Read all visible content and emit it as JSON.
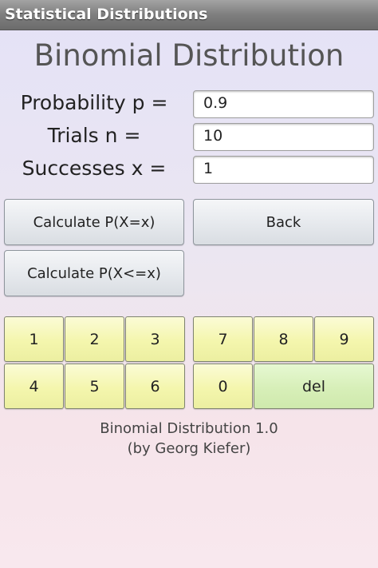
{
  "app": {
    "title": "Statistical Distributions"
  },
  "heading": "Binomial Distribution",
  "inputs": [
    {
      "label": "Probability p =",
      "value": "0.9"
    },
    {
      "label": "Trials n =",
      "value": "10"
    },
    {
      "label": "Successes x =",
      "value": "1"
    }
  ],
  "buttons": {
    "calc_eq": "Calculate P(X=x)",
    "back": "Back",
    "calc_le": "Calculate P(X<=x)"
  },
  "keypad": {
    "k1": "1",
    "k2": "2",
    "k3": "3",
    "k4": "4",
    "k5": "5",
    "k6": "6",
    "k7": "7",
    "k8": "8",
    "k9": "9",
    "k0": "0",
    "del": "del"
  },
  "footer": {
    "line1": "Binomial Distribution 1.0",
    "line2": "(by Georg Kiefer)"
  }
}
